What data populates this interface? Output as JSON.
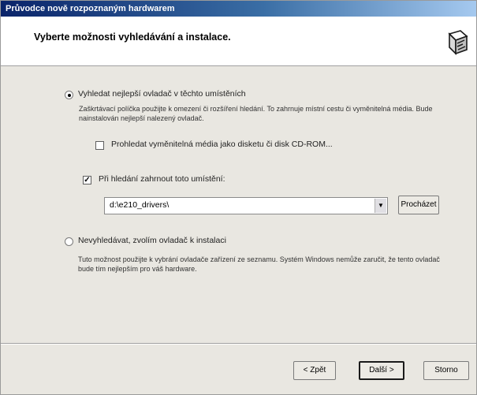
{
  "window": {
    "title": "Průvodce nově rozpoznaným hardwarem"
  },
  "header": {
    "title": "Vyberte možnosti vyhledávání a instalace."
  },
  "option_search": {
    "label": "Vyhledat nejlepší ovladač v těchto umístěních",
    "selected": true,
    "description": "Zaškrtávací políčka použijte k omezení či rozšíření hledání. To zahrnuje místní cestu či vyměnitelná média. Bude nainstalován nejlepší nalezený ovladač.",
    "checkbox_removable": {
      "label": "Prohledat vyměnitelná média jako disketu či disk CD-ROM...",
      "checked": false
    },
    "checkbox_location": {
      "label": "Při hledání zahrnout toto umístění:",
      "checked": true
    },
    "path_value": "d:\\e210_drivers\\",
    "browse_label": "Procházet"
  },
  "option_manual": {
    "label": "Nevyhledávat, zvolím ovladač k instalaci",
    "selected": false,
    "description": "Tuto možnost použijte k vybrání ovladače zařízení ze seznamu. Systém Windows nemůže zaručit, že tento ovladač bude tím nejlepším pro váš hardware."
  },
  "footer": {
    "back_label": "< Zpět",
    "next_label": "Další >",
    "cancel_label": "Storno"
  },
  "colors": {
    "title_gradient_start": "#0a246a",
    "title_gradient_end": "#a6caf0",
    "dialog_background": "#e9e7e1",
    "header_background": "#ffffff"
  }
}
